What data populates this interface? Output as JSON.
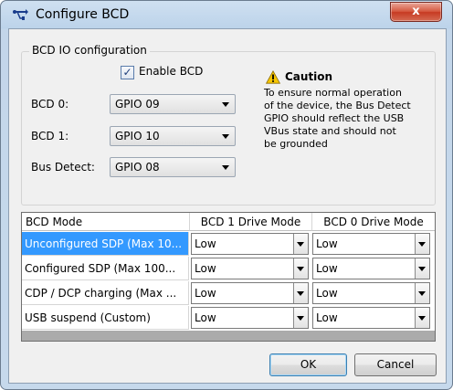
{
  "window": {
    "title": "Configure BCD",
    "close_label": "x"
  },
  "group": {
    "title": "BCD IO configuration",
    "enable": {
      "label": "Enable BCD",
      "checked": true,
      "check_mark": "✓"
    },
    "fields": [
      {
        "label": "BCD 0:",
        "value": "GPIO 09"
      },
      {
        "label": "BCD 1:",
        "value": "GPIO 10"
      },
      {
        "label": "Bus Detect:",
        "value": "GPIO 08"
      }
    ],
    "caution": {
      "title": "Caution",
      "lines": [
        "To ensure normal operation",
        "of the device, the Bus Detect",
        "GPIO should reflect the USB",
        "VBus state and should not",
        "be grounded"
      ]
    }
  },
  "table": {
    "headers": [
      "BCD Mode",
      "BCD 1 Drive Mode",
      "BCD 0 Drive Mode"
    ],
    "rows": [
      {
        "mode": "Unconfigured SDP (Max 10...",
        "bcd1": "Low",
        "bcd0": "Low",
        "selected": true
      },
      {
        "mode": "Configured SDP (Max 100...",
        "bcd1": "Low",
        "bcd0": "Low",
        "selected": false
      },
      {
        "mode": "CDP / DCP charging (Max ...",
        "bcd1": "Low",
        "bcd0": "Low",
        "selected": false
      },
      {
        "mode": "USB suspend (Custom)",
        "bcd1": "Low",
        "bcd0": "Low",
        "selected": false
      }
    ]
  },
  "buttons": {
    "ok": "OK",
    "cancel": "Cancel"
  },
  "colors": {
    "selection": "#3399ff",
    "close_button": "#c73a22",
    "warning": "#f7c600"
  },
  "icons": {
    "app": "usb-plug-icon",
    "warning": "warning-triangle-icon",
    "close": "close-icon",
    "dropdown": "chevron-down-icon"
  }
}
